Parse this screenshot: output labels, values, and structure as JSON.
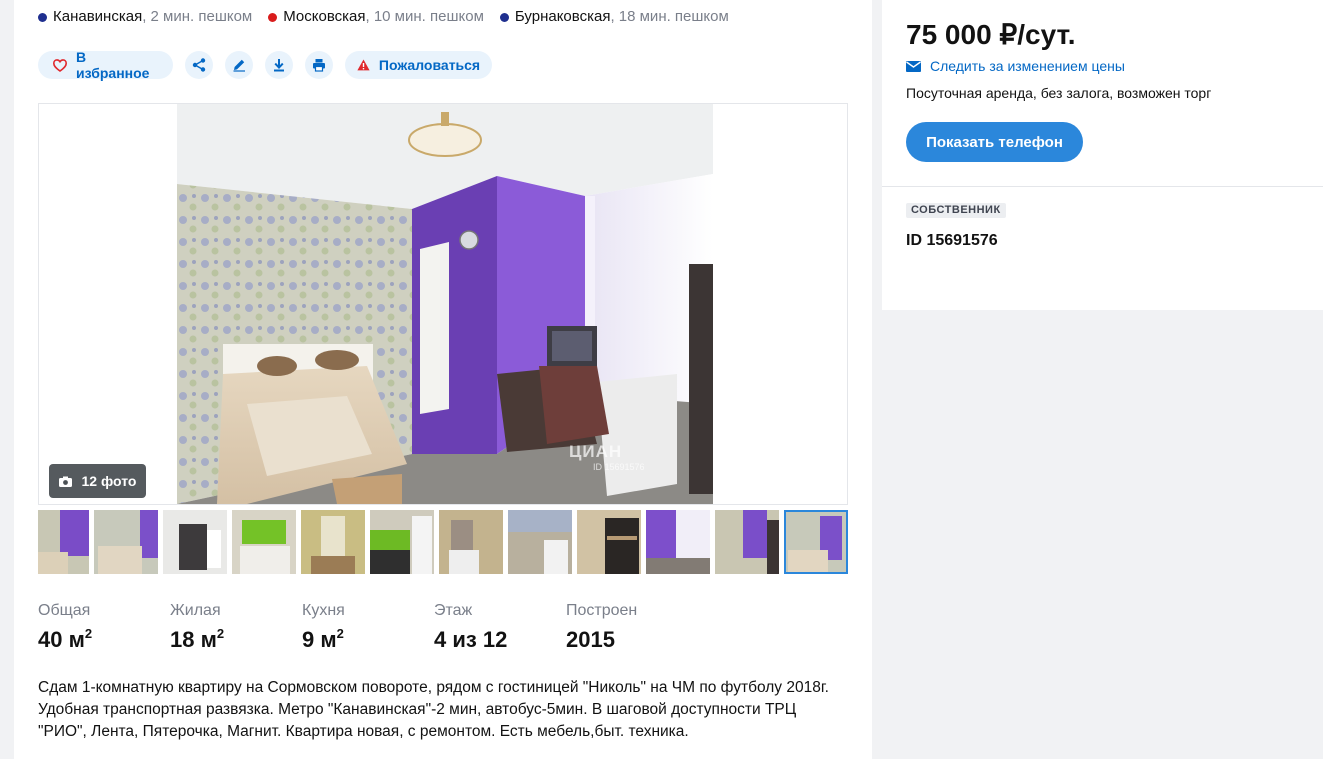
{
  "metro": [
    {
      "name": "Канавинская",
      "distance": ", 2 мин. пешком",
      "color": "#1f2f8f"
    },
    {
      "name": "Московская",
      "distance": ", 10 мин. пешком",
      "color": "#d91c1c"
    },
    {
      "name": "Бурнаковская",
      "distance": ", 18 мин. пешком",
      "color": "#1f2f8f"
    }
  ],
  "actions": {
    "favorite_label": "В избранное",
    "share_icon": "share-icon",
    "edit_icon": "pencil-icon",
    "download_icon": "download-icon",
    "print_icon": "print-icon",
    "complain_label": "Пожаловаться"
  },
  "gallery": {
    "photo_count_label": "12 фото",
    "watermark_brand": "ЦИАН",
    "watermark_id": "ID 15691576",
    "thumbnail_count": 12,
    "active_thumbnail": 12
  },
  "params": [
    {
      "label": "Общая",
      "value": "40 м",
      "sup": "2"
    },
    {
      "label": "Жилая",
      "value": "18 м",
      "sup": "2"
    },
    {
      "label": "Кухня",
      "value": "9 м",
      "sup": "2"
    },
    {
      "label": "Этаж",
      "value": "4 из 12",
      "sup": ""
    },
    {
      "label": "Построен",
      "value": "2015",
      "sup": ""
    }
  ],
  "description": "Сдам 1-комнатную квартиру на Сормовском повороте, рядом с гостиницей \"Николь\" на ЧМ по футболу 2018г. Удобная транспортная развязка. Метро \"Канавинская\"-2 мин, автобус-5мин. В шаговой доступности ТРЦ \"РИО\", Лента, Пятерочка, Магнит. Квартира новая, с ремонтом. Есть мебель,быт. техника.",
  "sidebar": {
    "price": "75 000 ₽/сут.",
    "watch_price_label": "Следить за изменением цены",
    "terms": "Посуточная аренда, без залога, возможен торг",
    "show_phone_label": "Показать телефон",
    "owner_badge": "СОБСТВЕННИК",
    "owner_id": "ID 15691576"
  },
  "colors": {
    "accent": "#2b87db",
    "link": "#0468c5",
    "pill_bg": "#e9f3fc",
    "complain_icon": "#e0292e"
  }
}
